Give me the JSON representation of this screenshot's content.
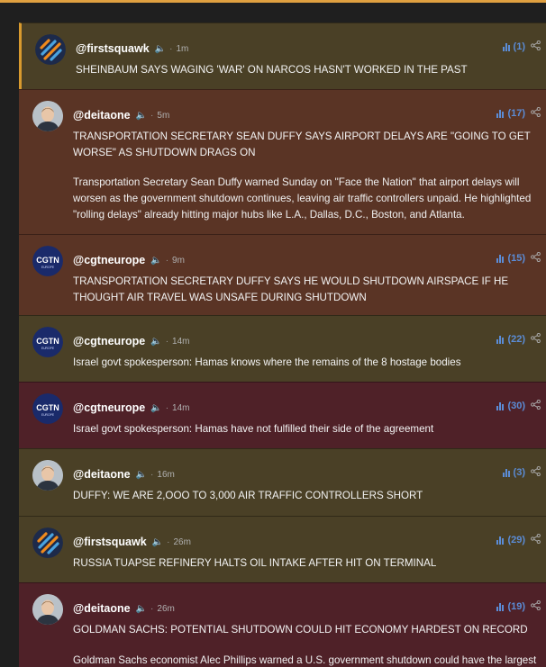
{
  "colors": {
    "accent_bar": "#d89a2e",
    "stats_blue": "#5b8cd6",
    "bg_olive": "#4a4026",
    "bg_rust": "#5a3425",
    "bg_plum": "#4f2128"
  },
  "posts": [
    {
      "handle": "@firstsquawk",
      "time": "1m",
      "stat": "(1)",
      "avatar": "firstsquawk-logo",
      "bg": "#4a4026",
      "title": "SHEINBAUM SAYS WAGING 'WAR' ON NARCOS HASN'T WORKED IN THE PAST",
      "body": ""
    },
    {
      "handle": "@deitaone",
      "time": "5m",
      "stat": "(17)",
      "avatar": "person-photo",
      "bg": "#5a3425",
      "title": "TRANSPORTATION SECRETARY SEAN DUFFY SAYS AIRPORT DELAYS ARE \"GOING TO GET WORSE\" AS SHUTDOWN DRAGS ON",
      "body": "Transportation Secretary Sean Duffy warned Sunday on \"Face the Nation\" that airport delays will worsen as the government shutdown continues, leaving air traffic controllers unpaid. He highlighted \"rolling delays\" already hitting major hubs like L.A., Dallas, D.C., Boston, and Atlanta."
    },
    {
      "handle": "@cgtneurope",
      "time": "9m",
      "stat": "(15)",
      "avatar": "cgtn-logo",
      "bg": "#5a3425",
      "title": "TRANSPORTATION SECRETARY DUFFY SAYS HE WOULD SHUTDOWN AIRSPACE IF HE THOUGHT AIR TRAVEL WAS UNSAFE DURING SHUTDOWN",
      "body": ""
    },
    {
      "handle": "@cgtneurope",
      "time": "14m",
      "stat": "(22)",
      "avatar": "cgtn-logo",
      "bg": "#4a4026",
      "title": "Israel govt spokesperson: Hamas knows where the remains of the 8 hostage bodies",
      "body": ""
    },
    {
      "handle": "@cgtneurope",
      "time": "14m",
      "stat": "(30)",
      "avatar": "cgtn-logo",
      "bg": "#4f2128",
      "title": "Israel govt spokesperson: Hamas have not fulfilled their side of the agreement",
      "body": ""
    },
    {
      "handle": "@deitaone",
      "time": "16m",
      "stat": "(3)",
      "avatar": "person-photo",
      "bg": "#4a4026",
      "title": "DUFFY: WE ARE 2,OOO TO 3,000 AIR TRAFFIC CONTROLLERS SHORT",
      "body": ""
    },
    {
      "handle": "@firstsquawk",
      "time": "26m",
      "stat": "(29)",
      "avatar": "firstsquawk-logo",
      "bg": "#4a4026",
      "title": "RUSSIA TUAPSE REFINERY HALTS OIL INTAKE AFTER HIT ON TERMINAL",
      "body": ""
    },
    {
      "handle": "@deitaone",
      "time": "26m",
      "stat": "(19)",
      "avatar": "person-photo",
      "bg": "#4f2128",
      "title": "GOLDMAN SACHS: POTENTIAL SHUTDOWN COULD HIT ECONOMY HARDEST ON RECORD",
      "body": "Goldman Sachs economist Alec Phillips warned a U.S. government shutdown could have the largest"
    }
  ]
}
